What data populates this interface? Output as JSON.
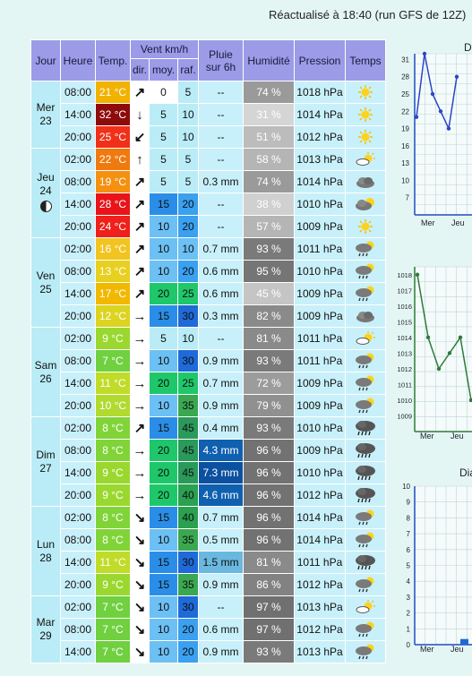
{
  "update_text": "Réactualisé à 18:40 (run GFS de 12Z)",
  "headers": {
    "jour": "Jour",
    "heure": "Heure",
    "temp": "Temp.",
    "vent": "Vent km/h",
    "dir": "dir.",
    "moy": "moy.",
    "raf": "raf.",
    "pluie1": "Pluie",
    "pluie2": "sur 6h",
    "humidite": "Humidité",
    "pression": "Pression",
    "temps": "Temps"
  },
  "days": [
    {
      "name": "Mer",
      "date": "23",
      "moon": false,
      "rows": [
        {
          "h": "08:00",
          "t": "21 °C",
          "tc": "#f2b200",
          "d": "↗",
          "m": "0",
          "r": "5",
          "mc": "#ffffff",
          "rc": "#b9ecf6",
          "p": "--",
          "pc": "#c8f0fa",
          "hu": "74 %",
          "hc": "#9a9a9a",
          "pr": "1018 hPa",
          "wx": "sun"
        },
        {
          "h": "14:00",
          "t": "32 °C",
          "tc": "#8e0b0b",
          "d": "↓",
          "m": "5",
          "r": "10",
          "mc": "#b9ecf6",
          "rc": "#b9ecf6",
          "p": "--",
          "pc": "#c8f0fa",
          "hu": "31 %",
          "hc": "#d5d5d5",
          "pr": "1014 hPa",
          "wx": "sun"
        },
        {
          "h": "20:00",
          "t": "25 °C",
          "tc": "#f03018",
          "d": "↙",
          "m": "5",
          "r": "10",
          "mc": "#b9ecf6",
          "rc": "#b9ecf6",
          "p": "--",
          "pc": "#c8f0fa",
          "hu": "51 %",
          "hc": "#bcbcbc",
          "pr": "1012 hPa",
          "wx": "sun"
        }
      ]
    },
    {
      "name": "Jeu",
      "date": "24",
      "moon": true,
      "rows": [
        {
          "h": "02:00",
          "t": "22 °C",
          "tc": "#f07a10",
          "d": "↑",
          "m": "5",
          "r": "5",
          "mc": "#b9ecf6",
          "rc": "#b9ecf6",
          "p": "--",
          "pc": "#c8f0fa",
          "hu": "58 %",
          "hc": "#b5b5b5",
          "pr": "1013 hPa",
          "wx": "suncloud"
        },
        {
          "h": "08:00",
          "t": "19 °C",
          "tc": "#f59010",
          "d": "↗",
          "m": "5",
          "r": "5",
          "mc": "#b9ecf6",
          "rc": "#b9ecf6",
          "p": "0.3 mm",
          "pc": "#c8f0fa",
          "hu": "74 %",
          "hc": "#9a9a9a",
          "pr": "1014 hPa",
          "wx": "cloud"
        },
        {
          "h": "14:00",
          "t": "28 °C",
          "tc": "#e8141a",
          "d": "↗",
          "m": "15",
          "r": "20",
          "mc": "#2a8ee8",
          "rc": "#3aa0f0",
          "p": "--",
          "pc": "#c8f0fa",
          "hu": "38 %",
          "hc": "#d0d0d0",
          "pr": "1010 hPa",
          "wx": "cloudsun"
        },
        {
          "h": "20:00",
          "t": "24 °C",
          "tc": "#f0201a",
          "d": "↗",
          "m": "10",
          "r": "20",
          "mc": "#6cc0f4",
          "rc": "#3aa0f0",
          "p": "--",
          "pc": "#c8f0fa",
          "hu": "57 %",
          "hc": "#b5b5b5",
          "pr": "1009 hPa",
          "wx": "sun"
        }
      ]
    },
    {
      "name": "Ven",
      "date": "25",
      "moon": false,
      "rows": [
        {
          "h": "02:00",
          "t": "16 °C",
          "tc": "#f2c420",
          "d": "↗",
          "m": "10",
          "r": "10",
          "mc": "#6cc0f4",
          "rc": "#6cc0f4",
          "p": "0.7 mm",
          "pc": "#c8f0fa",
          "hu": "93 %",
          "hc": "#7a7a7a",
          "pr": "1011 hPa",
          "wx": "rain"
        },
        {
          "h": "08:00",
          "t": "13 °C",
          "tc": "#e8d020",
          "d": "↗",
          "m": "10",
          "r": "20",
          "mc": "#6cc0f4",
          "rc": "#3aa0f0",
          "p": "0.6 mm",
          "pc": "#c8f0fa",
          "hu": "95 %",
          "hc": "#757575",
          "pr": "1010 hPa",
          "wx": "rain"
        },
        {
          "h": "14:00",
          "t": "17 °C",
          "tc": "#f2b800",
          "d": "↗",
          "m": "20",
          "r": "25",
          "mc": "#1ec86a",
          "rc": "#1ec86a",
          "p": "0.6 mm",
          "pc": "#c8f0fa",
          "hu": "45 %",
          "hc": "#c5c5c5",
          "pr": "1009 hPa",
          "wx": "rain"
        },
        {
          "h": "20:00",
          "t": "12 °C",
          "tc": "#dcd420",
          "d": "→",
          "m": "15",
          "r": "30",
          "mc": "#2a8ee8",
          "rc": "#1e6ad8",
          "p": "0.3 mm",
          "pc": "#c8f0fa",
          "hu": "82 %",
          "hc": "#8a8a8a",
          "pr": "1009 hPa",
          "wx": "cloud"
        }
      ]
    },
    {
      "name": "Sam",
      "date": "26",
      "moon": false,
      "rows": [
        {
          "h": "02:00",
          "t": "9 °C",
          "tc": "#9ad830",
          "d": "→",
          "m": "5",
          "r": "10",
          "mc": "#b9ecf6",
          "rc": "#b9ecf6",
          "p": "--",
          "pc": "#c8f0fa",
          "hu": "81 %",
          "hc": "#8a8a8a",
          "pr": "1011 hPa",
          "wx": "suncloud"
        },
        {
          "h": "08:00",
          "t": "7 °C",
          "tc": "#70d040",
          "d": "→",
          "m": "10",
          "r": "30",
          "mc": "#6cc0f4",
          "rc": "#1e6ad8",
          "p": "0.9 mm",
          "pc": "#c8f0fa",
          "hu": "93 %",
          "hc": "#7a7a7a",
          "pr": "1011 hPa",
          "wx": "rain"
        },
        {
          "h": "14:00",
          "t": "11 °C",
          "tc": "#c0dc28",
          "d": "→",
          "m": "20",
          "r": "25",
          "mc": "#1ec86a",
          "rc": "#1ec86a",
          "p": "0.7 mm",
          "pc": "#c8f0fa",
          "hu": "72 %",
          "hc": "#9c9c9c",
          "pr": "1009 hPa",
          "wx": "rain"
        },
        {
          "h": "20:00",
          "t": "10 °C",
          "tc": "#b0da30",
          "d": "→",
          "m": "10",
          "r": "35",
          "mc": "#6cc0f4",
          "rc": "#3aa850",
          "p": "0.9 mm",
          "pc": "#c8f0fa",
          "hu": "79 %",
          "hc": "#909090",
          "pr": "1009 hPa",
          "wx": "rain"
        }
      ]
    },
    {
      "name": "Dim",
      "date": "27",
      "moon": false,
      "rows": [
        {
          "h": "02:00",
          "t": "8 °C",
          "tc": "#80d438",
          "d": "↗",
          "m": "15",
          "r": "45",
          "mc": "#2a8ee8",
          "rc": "#2a9a5a",
          "p": "0.4 mm",
          "pc": "#c8f0fa",
          "hu": "93 %",
          "hc": "#7a7a7a",
          "pr": "1010 hPa",
          "wx": "storm"
        },
        {
          "h": "08:00",
          "t": "8 °C",
          "tc": "#80d438",
          "d": "→",
          "m": "20",
          "r": "45",
          "mc": "#1ec86a",
          "rc": "#2a9a5a",
          "p": "4.3 mm",
          "pc": "#1060b0",
          "hu": "96 %",
          "hc": "#727272",
          "pr": "1009 hPa",
          "wx": "storm"
        },
        {
          "h": "14:00",
          "t": "9 °C",
          "tc": "#9ad830",
          "d": "→",
          "m": "20",
          "r": "45",
          "mc": "#1ec86a",
          "rc": "#2a9a5a",
          "p": "7.3 mm",
          "pc": "#0c50a0",
          "hu": "96 %",
          "hc": "#727272",
          "pr": "1010 hPa",
          "wx": "storm"
        },
        {
          "h": "20:00",
          "t": "9 °C",
          "tc": "#9ad830",
          "d": "→",
          "m": "20",
          "r": "40",
          "mc": "#1ec86a",
          "rc": "#2aa050",
          "p": "4.6 mm",
          "pc": "#1060b0",
          "hu": "96 %",
          "hc": "#727272",
          "pr": "1012 hPa",
          "wx": "storm"
        }
      ]
    },
    {
      "name": "Lun",
      "date": "28",
      "moon": false,
      "rows": [
        {
          "h": "02:00",
          "t": "8 °C",
          "tc": "#80d438",
          "d": "↘",
          "m": "15",
          "r": "40",
          "mc": "#2a8ee8",
          "rc": "#2aa050",
          "p": "0.7 mm",
          "pc": "#c8f0fa",
          "hu": "96 %",
          "hc": "#727272",
          "pr": "1014 hPa",
          "wx": "rain"
        },
        {
          "h": "08:00",
          "t": "8 °C",
          "tc": "#80d438",
          "d": "↘",
          "m": "10",
          "r": "35",
          "mc": "#6cc0f4",
          "rc": "#3aa850",
          "p": "0.5 mm",
          "pc": "#c8f0fa",
          "hu": "96 %",
          "hc": "#727272",
          "pr": "1014 hPa",
          "wx": "rain"
        },
        {
          "h": "14:00",
          "t": "11 °C",
          "tc": "#c0dc28",
          "d": "↘",
          "m": "15",
          "r": "30",
          "mc": "#2a8ee8",
          "rc": "#1e6ad8",
          "p": "1.5 mm",
          "pc": "#6ab8e0",
          "hu": "81 %",
          "hc": "#8a8a8a",
          "pr": "1011 hPa",
          "wx": "storm"
        },
        {
          "h": "20:00",
          "t": "9 °C",
          "tc": "#9ad830",
          "d": "↘",
          "m": "15",
          "r": "35",
          "mc": "#2a8ee8",
          "rc": "#3aa850",
          "p": "0.9 mm",
          "pc": "#c8f0fa",
          "hu": "86 %",
          "hc": "#828282",
          "pr": "1012 hPa",
          "wx": "rain"
        }
      ]
    },
    {
      "name": "Mar",
      "date": "29",
      "moon": false,
      "rows": [
        {
          "h": "02:00",
          "t": "7 °C",
          "tc": "#70d040",
          "d": "↘",
          "m": "10",
          "r": "30",
          "mc": "#6cc0f4",
          "rc": "#1e6ad8",
          "p": "--",
          "pc": "#c8f0fa",
          "hu": "97 %",
          "hc": "#707070",
          "pr": "1013 hPa",
          "wx": "suncloud"
        },
        {
          "h": "08:00",
          "t": "7 °C",
          "tc": "#70d040",
          "d": "↘",
          "m": "10",
          "r": "20",
          "mc": "#6cc0f4",
          "rc": "#3aa0f0",
          "p": "0.6 mm",
          "pc": "#c8f0fa",
          "hu": "97 %",
          "hc": "#707070",
          "pr": "1012 hPa",
          "wx": "rain"
        },
        {
          "h": "14:00",
          "t": "7 °C",
          "tc": "#70d040",
          "d": "↘",
          "m": "10",
          "r": "20",
          "mc": "#6cc0f4",
          "rc": "#3aa0f0",
          "p": "0.9 mm",
          "pc": "#c8f0fa",
          "hu": "93 %",
          "hc": "#7a7a7a",
          "pr": "1013 hPa",
          "wx": "rain"
        }
      ]
    }
  ],
  "charts": {
    "temp_title": "D",
    "press_title": "",
    "rain_title": "Dia",
    "day_labels": [
      "Mer",
      "Jeu"
    ],
    "temp_ticks": [
      "31",
      "28",
      "25",
      "22",
      "19",
      "16",
      "13",
      "10",
      "7"
    ],
    "press_ticks": [
      "1018",
      "1017",
      "1016",
      "1015",
      "1014",
      "1013",
      "1012",
      "1011",
      "1010",
      "1009"
    ],
    "rain_ticks": [
      "10",
      "9",
      "8",
      "7",
      "6",
      "5",
      "4",
      "3",
      "2",
      "1",
      "0"
    ]
  },
  "chart_data": [
    {
      "type": "line",
      "title": "",
      "ylim": [
        4,
        32
      ],
      "x": [
        "Mer 08:00",
        "Mer 14:00",
        "Mer 20:00",
        "Jeu 02:00",
        "Jeu 08:00",
        "Jeu 14:00"
      ],
      "series": [
        {
          "values": [
            21,
            32,
            25,
            22,
            19,
            28
          ]
        }
      ]
    },
    {
      "type": "line",
      "title": "",
      "ylim": [
        1008,
        1018.5
      ],
      "x": [
        "Mer 08:00",
        "Mer 14:00",
        "Mer 20:00",
        "Jeu 02:00",
        "Jeu 08:00",
        "Jeu 14:00"
      ],
      "series": [
        {
          "values": [
            1018,
            1014,
            1012,
            1013,
            1014,
            1010
          ]
        }
      ]
    },
    {
      "type": "bar",
      "title": "",
      "ylim": [
        0,
        10
      ],
      "categories": [
        "Mer 08:00",
        "Mer 14:00",
        "Mer 20:00",
        "Jeu 02:00",
        "Jeu 08:00"
      ],
      "values": [
        0,
        0,
        0,
        0,
        0.3
      ]
    }
  ]
}
